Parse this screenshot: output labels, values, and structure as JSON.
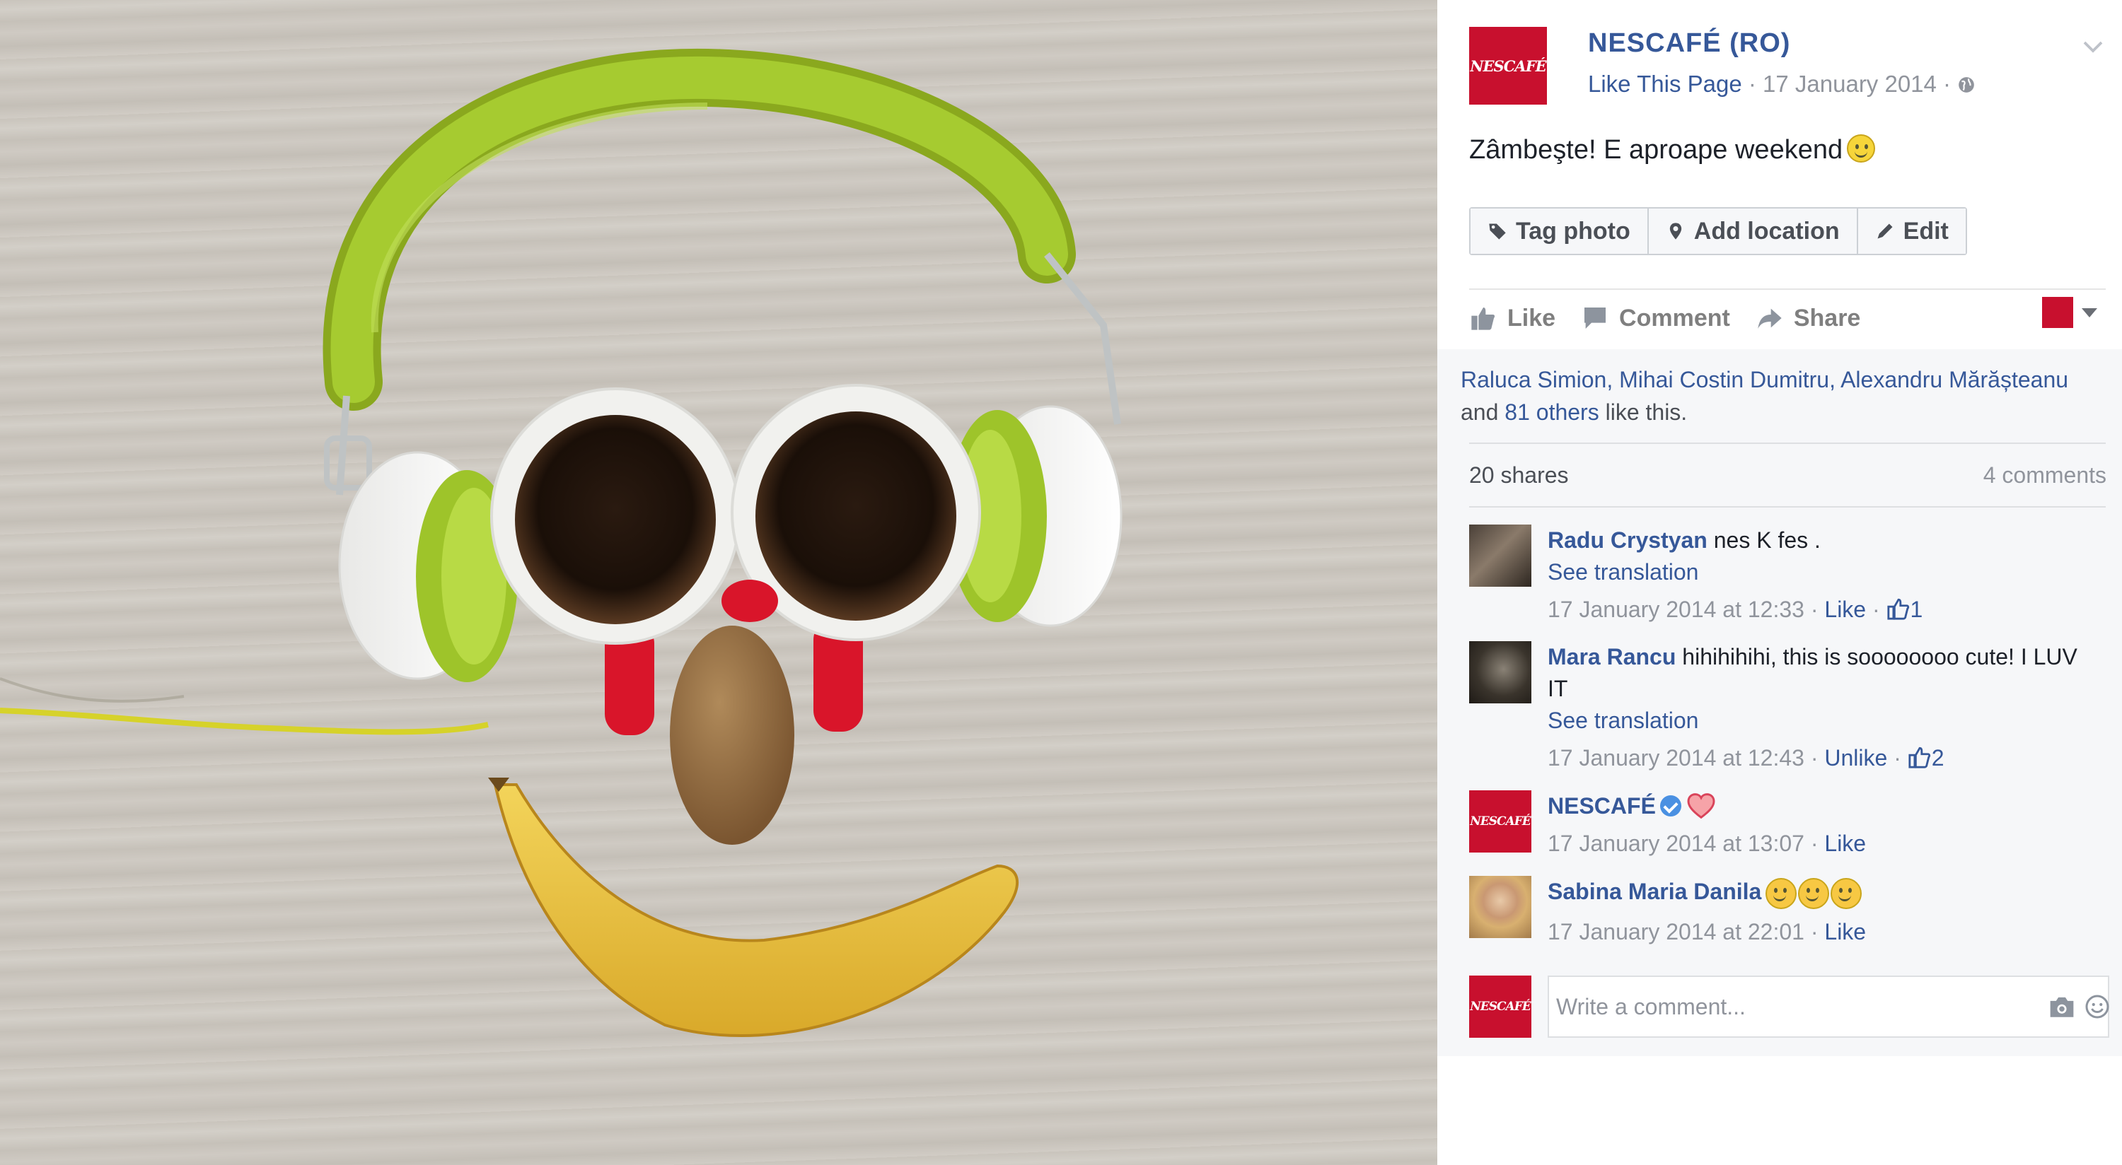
{
  "post": {
    "page_name": "NESCAFÉ (RO)",
    "avatar_text": "NESCAFÉ",
    "like_page": "Like This Page",
    "meta_sep": " · ",
    "date": "17 January 2014",
    "caption": "Zâmbeşte! E aproape weekend"
  },
  "photo_actions": {
    "tag": "Tag photo",
    "location": "Add location",
    "edit": "Edit"
  },
  "ufi": {
    "like": "Like",
    "comment": "Comment",
    "share": "Share"
  },
  "likers": {
    "names": "Raluca Simion, Mihai Costin Dumitru, Alexandru Mărășteanu",
    "and": "and ",
    "others": "81 others",
    "suffix": " like this."
  },
  "counts": {
    "shares": "20 shares",
    "comments": "4 comments"
  },
  "comments": [
    {
      "author": "Radu Crystyan",
      "text": " nes K fes .",
      "see_translation": "See translation",
      "time": "17 January 2014 at 12:33",
      "action": "Like",
      "likes": "1"
    },
    {
      "author": "Mara Rancu",
      "text": " hihihihihi, this is soooooooo cute! I LUV IT",
      "see_translation": "See translation",
      "time": "17 January 2014 at 12:43",
      "action": "Unlike",
      "likes": "2"
    },
    {
      "author": "NESCAFÉ",
      "time": "17 January 2014 at 13:07",
      "action": "Like"
    },
    {
      "author": "Sabina Maria Danila",
      "time": "17 January 2014 at 22:01",
      "action": "Like"
    }
  ],
  "composer": {
    "placeholder": "Write a comment..."
  },
  "colors": {
    "brand_red": "#c8102e",
    "link_blue": "#365899",
    "headphone_green": "#9fc42a"
  }
}
